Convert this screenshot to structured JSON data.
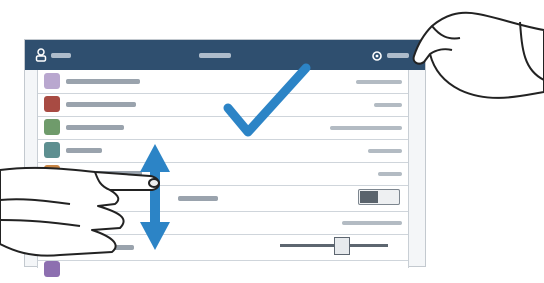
{
  "screen": {
    "topbar": {
      "left_label": "",
      "title": "",
      "right_label": ""
    },
    "rows": [
      {
        "icon": "app-icon-purple",
        "has_value": true,
        "control": "none"
      },
      {
        "icon": "app-icon-red",
        "has_value": true,
        "control": "none"
      },
      {
        "icon": "app-icon-green",
        "has_value": true,
        "control": "none"
      },
      {
        "icon": "app-icon-teal",
        "has_value": true,
        "control": "none"
      },
      {
        "icon": "app-icon-orange",
        "has_value": true,
        "control": "none"
      },
      {
        "icon": "none",
        "has_value": false,
        "control": "toggle"
      },
      {
        "icon": "none",
        "has_value": true,
        "control": "none"
      },
      {
        "icon": "none",
        "has_value": false,
        "control": "slider"
      },
      {
        "icon": "app-icon-purple",
        "has_value": false,
        "control": "none"
      }
    ]
  },
  "overlay": {
    "checkmark_color": "#2c84c6",
    "arrow_color": "#2c84c6",
    "gestures": [
      "tap",
      "swipe-vertical"
    ]
  },
  "colors": {
    "topbar": "#2f4f6f",
    "list_bg": "#ffffff",
    "divider": "#cfd5db"
  }
}
